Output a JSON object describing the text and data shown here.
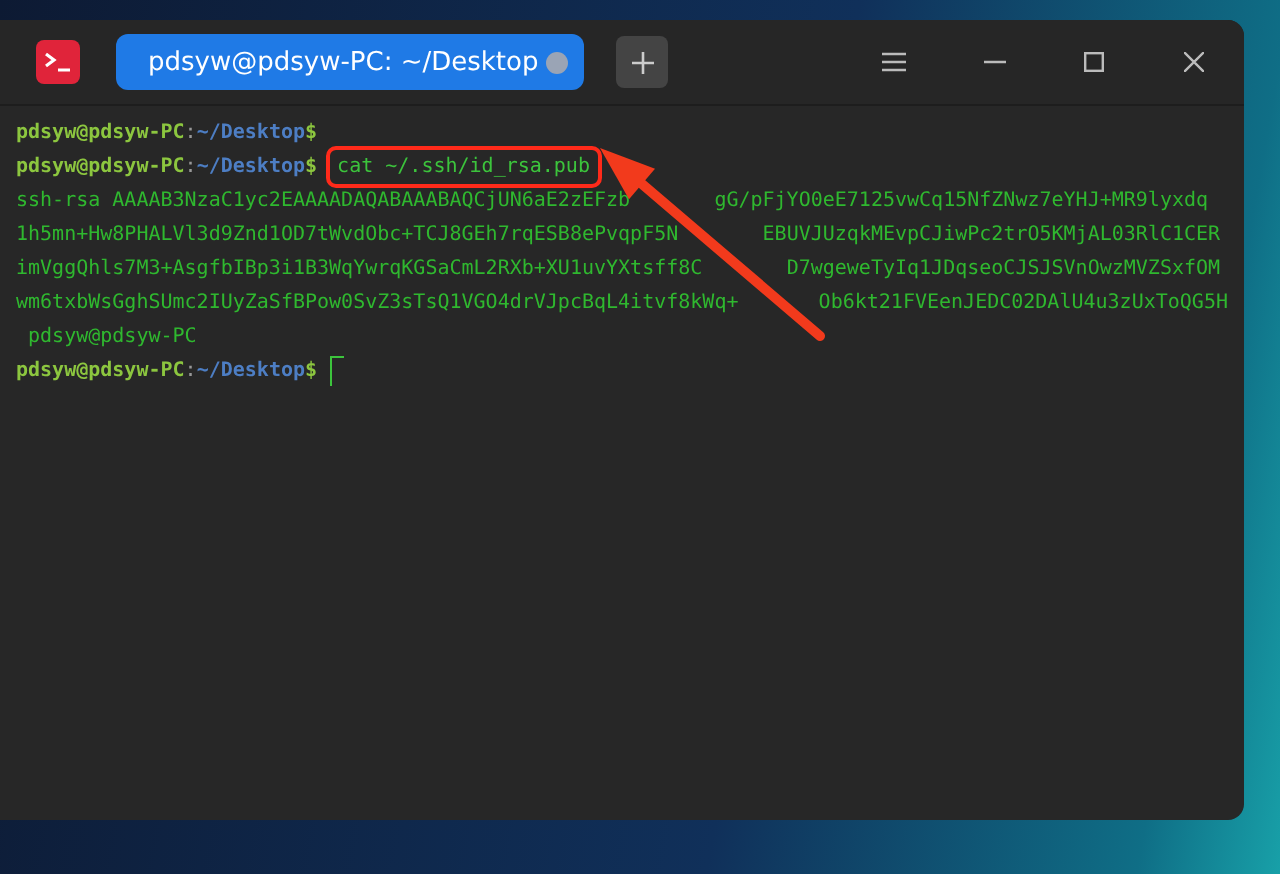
{
  "window": {
    "tab_title": "pdsyw@pdsyw-PC: ~/Desktop"
  },
  "terminal": {
    "lines": [
      {
        "kind": "prompt",
        "user": "pdsyw@pdsyw-PC",
        "separator": ":",
        "path": "~/Desktop",
        "symbol": "$"
      },
      {
        "kind": "prompt",
        "user": "pdsyw@pdsyw-PC",
        "separator": ":",
        "path": "~/Desktop",
        "symbol": "$",
        "command": "cat ~/.ssh/id_rsa.pub",
        "highlighted": true
      },
      {
        "kind": "output",
        "segments": [
          "ssh-rsa AAAAB3NzaC1yc2EAAAADAQABAAABAQCjUN6aE2zEFzb",
          "gG/pFjYO0eE7125vwCq15NfZNwz7eYHJ+MR9lyxdq"
        ]
      },
      {
        "kind": "output",
        "segments": [
          "1h5mn+Hw8PHALVl3d9Znd1OD7tWvdObc+TCJ8GEh7rqESB8ePvqpF5N",
          "EBUVJUzqkMEvpCJiwPc2trO5KMjAL03RlC1CER"
        ]
      },
      {
        "kind": "output",
        "segments": [
          "imVggQhls7M3+AsgfbIBp3i1B3WqYwrqKGSaCmL2RXb+XU1uvYXtsff8C",
          "D7wgeweTyIq1JDqseoCJSJSVnOwzMVZSxfOM"
        ]
      },
      {
        "kind": "output",
        "segments": [
          "wm6txbWsGghSUmc2IUyZaSfBPow0SvZ3sTsQ1VGO4drVJpcBqL4itvf8kWq+",
          "Ob6kt21FVEenJEDC02DAlU4u3zUxToQG5H"
        ]
      },
      {
        "kind": "output",
        "segments": [
          " pdsyw@pdsyw-PC"
        ]
      },
      {
        "kind": "prompt",
        "user": "pdsyw@pdsyw-PC",
        "separator": ":",
        "path": "~/Desktop",
        "symbol": "$",
        "cursor": true
      }
    ]
  }
}
